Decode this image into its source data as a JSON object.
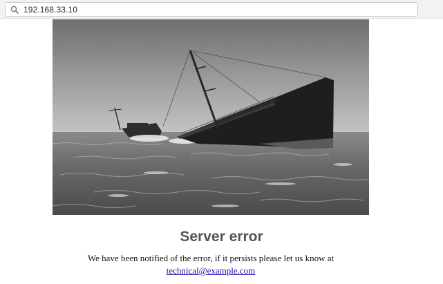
{
  "browser": {
    "url": "192.168.33.10",
    "search_icon": "search-icon"
  },
  "hero_image": {
    "subject": "ship-sinking-photo"
  },
  "error": {
    "title": "Server error",
    "message": "We have been notified of the error, if it persists please let us know at",
    "email": "technical@example.com"
  }
}
